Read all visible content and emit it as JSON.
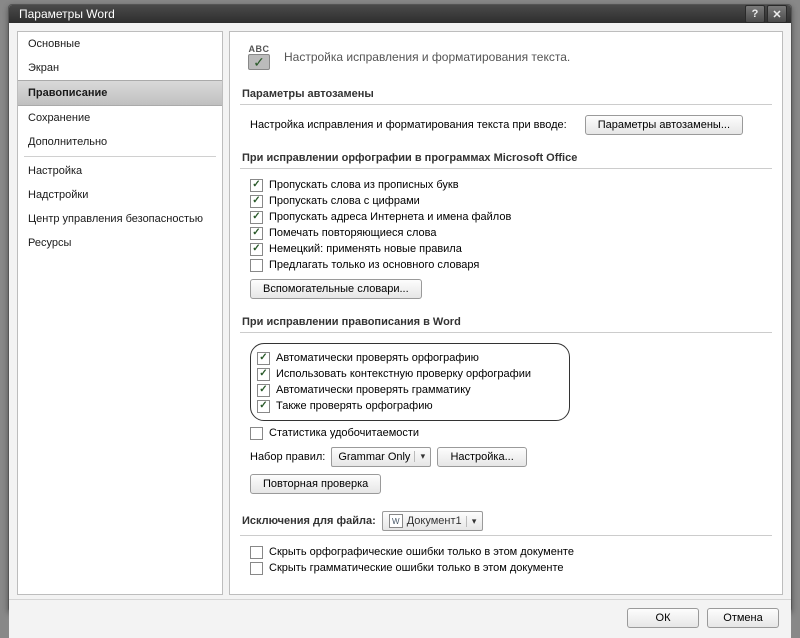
{
  "title": "Параметры Word",
  "sidebar": {
    "items": [
      "Основные",
      "Экран",
      "Правописание",
      "Сохранение",
      "Дополнительно",
      "Настройка",
      "Надстройки",
      "Центр управления безопасностью",
      "Ресурсы"
    ],
    "selected_index": 2
  },
  "header_desc": "Настройка исправления и форматирования текста.",
  "groups": {
    "autocorrect": {
      "title": "Параметры автозамены",
      "text": "Настройка исправления и форматирования текста при вводе:",
      "button": "Параметры автозамены..."
    },
    "office": {
      "title": "При исправлении орфографии в программах Microsoft Office",
      "items": [
        {
          "checked": true,
          "label": "Пропускать слова из прописных букв"
        },
        {
          "checked": true,
          "label": "Пропускать слова с цифрами"
        },
        {
          "checked": true,
          "label": "Пропускать адреса Интернета и имена файлов"
        },
        {
          "checked": true,
          "label": "Помечать повторяющиеся слова"
        },
        {
          "checked": true,
          "label": "Немецкий: применять новые правила"
        },
        {
          "checked": false,
          "label": "Предлагать только из основного словаря"
        }
      ],
      "dict_button": "Вспомогательные словари..."
    },
    "word": {
      "title": "При исправлении правописания в Word",
      "callout": [
        {
          "checked": true,
          "label": "Автоматически проверять орфографию"
        },
        {
          "checked": true,
          "label": "Использовать контекстную проверку орфографии"
        },
        {
          "checked": true,
          "label": "Автоматически проверять грамматику"
        },
        {
          "checked": true,
          "label": "Также проверять орфографию"
        }
      ],
      "stats": {
        "checked": false,
        "label": "Статистика удобочитаемости"
      },
      "ruleset_label": "Набор правил:",
      "ruleset_value": "Grammar Only",
      "settings_btn": "Настройка...",
      "recheck_btn": "Повторная проверка"
    },
    "exceptions": {
      "title": "Исключения для файла:",
      "file": "Документ1",
      "items": [
        {
          "checked": false,
          "label": "Скрыть орфографические ошибки только в этом документе"
        },
        {
          "checked": false,
          "label": "Скрыть грамматические ошибки только в этом документе"
        }
      ]
    }
  },
  "footer": {
    "ok": "ОК",
    "cancel": "Отмена"
  }
}
